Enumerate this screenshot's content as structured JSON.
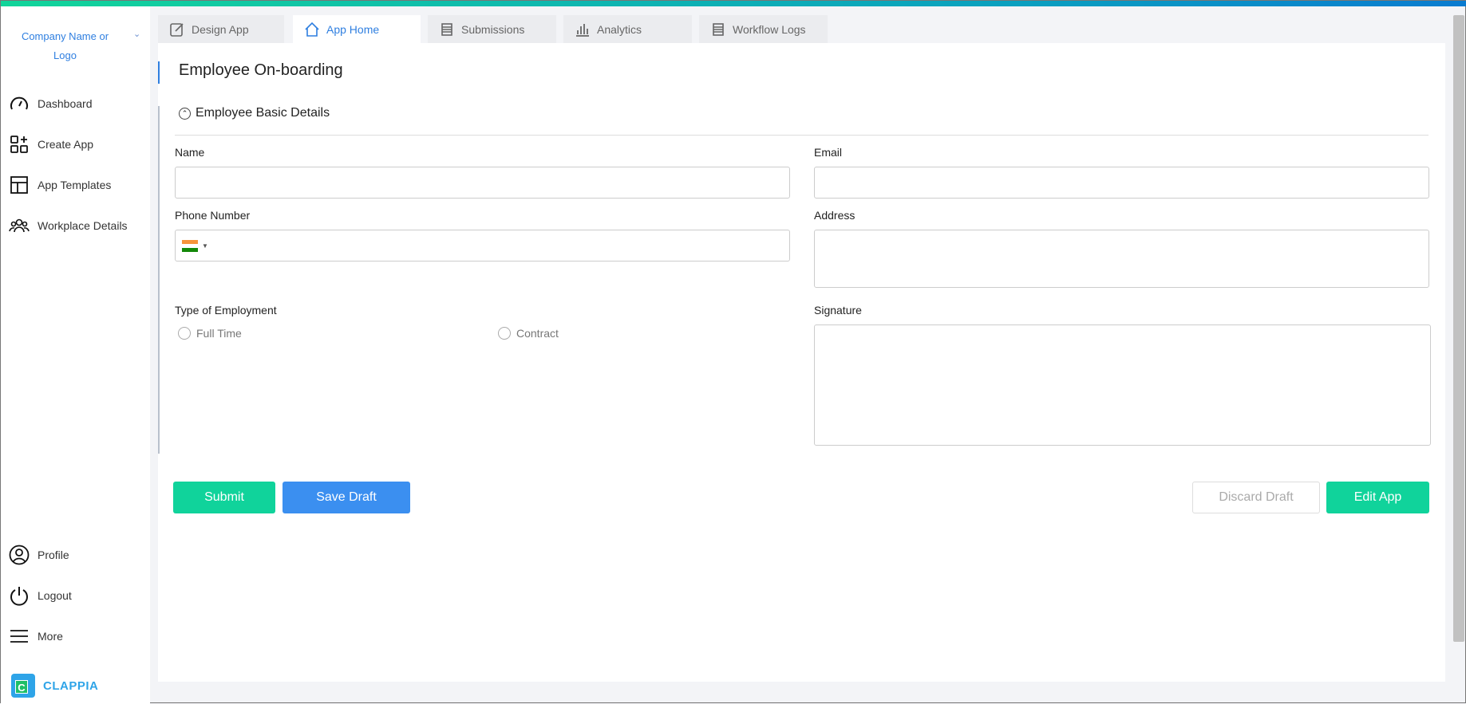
{
  "sidebar": {
    "company": "Company Name or Logo",
    "items": [
      {
        "label": "Dashboard"
      },
      {
        "label": "Create App"
      },
      {
        "label": "App Templates"
      },
      {
        "label": "Workplace Details"
      }
    ],
    "bottom_items": [
      {
        "label": "Profile"
      },
      {
        "label": "Logout"
      },
      {
        "label": "More"
      }
    ],
    "brand": "CLAPPIA"
  },
  "tabs": [
    {
      "label": "Design App"
    },
    {
      "label": "App Home"
    },
    {
      "label": "Submissions"
    },
    {
      "label": "Analytics"
    },
    {
      "label": "Workflow Logs"
    }
  ],
  "form": {
    "title": "Employee On-boarding",
    "section": "Employee Basic Details",
    "fields": {
      "name": "Name",
      "email": "Email",
      "phone": "Phone Number",
      "address": "Address",
      "employment": "Type of Employment",
      "signature": "Signature"
    },
    "employment_options": [
      "Full Time",
      "Contract"
    ],
    "buttons": {
      "submit": "Submit",
      "save_draft": "Save Draft",
      "discard_draft": "Discard Draft",
      "edit_app": "Edit App"
    }
  },
  "colors": {
    "accent": "#2f7fe0",
    "green": "#10d39b",
    "blue": "#3b8ff0"
  }
}
